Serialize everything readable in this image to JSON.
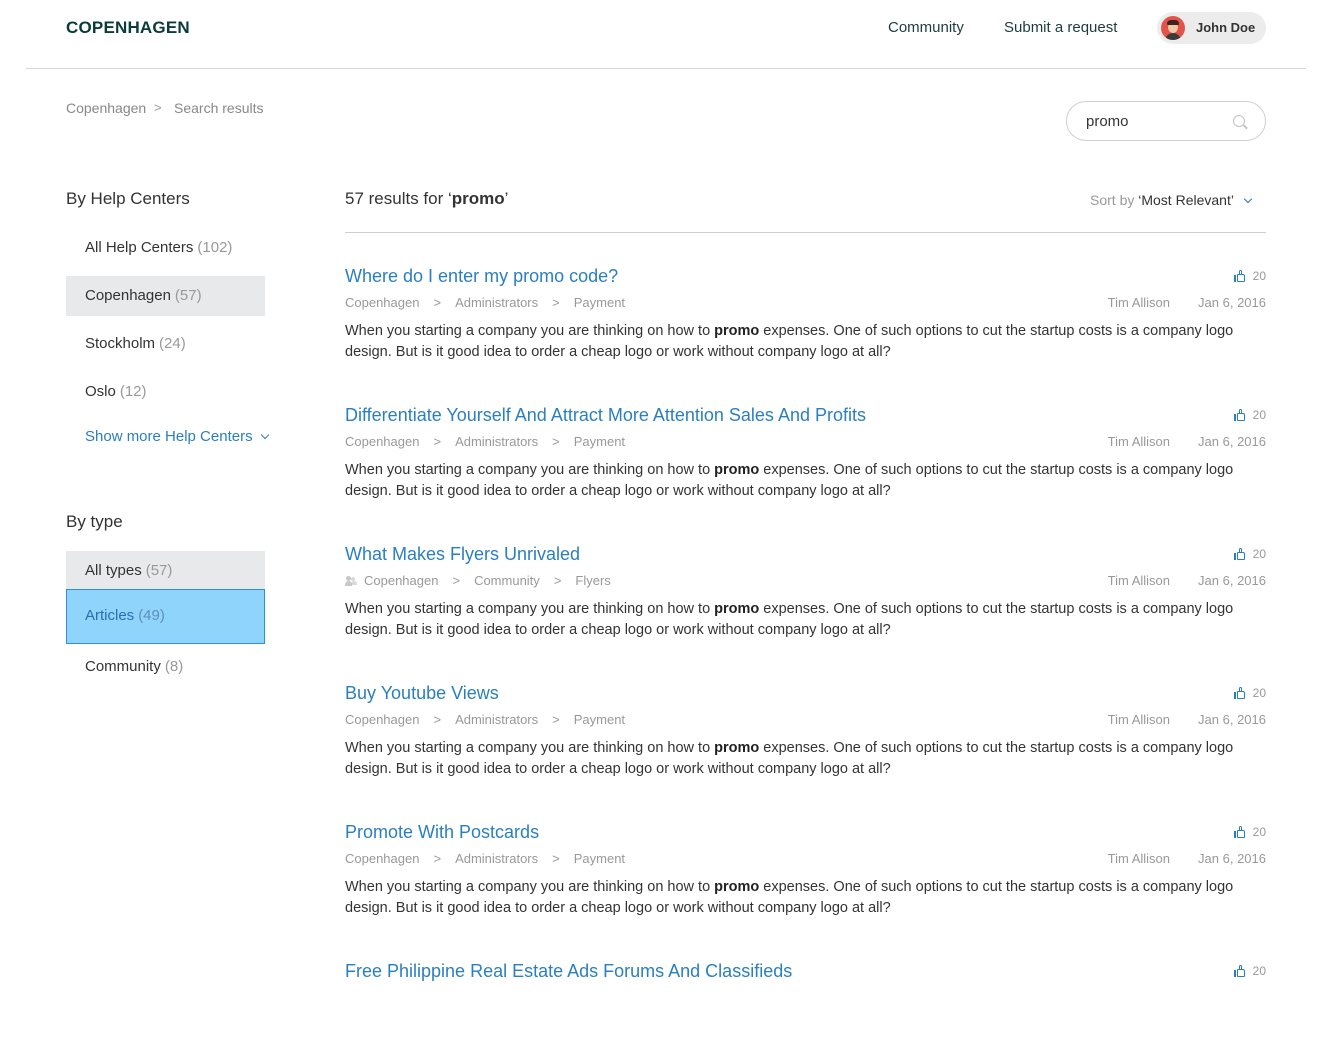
{
  "header": {
    "logo": "COPENHAGEN",
    "nav": {
      "community": "Community",
      "submit_request": "Submit a request"
    },
    "user_name": "John Doe"
  },
  "breadcrumb": {
    "home": "Copenhagen",
    "separator": ">",
    "current": "Search results"
  },
  "search": {
    "value": "promo"
  },
  "sidebar": {
    "help_centers_heading": "By Help Centers",
    "help_centers": [
      {
        "label": "All Help Centers",
        "count": "(102)"
      },
      {
        "label": "Copenhagen",
        "count": "(57)"
      },
      {
        "label": "Stockholm",
        "count": "(24)"
      },
      {
        "label": "Oslo",
        "count": "(12)"
      }
    ],
    "show_more": "Show more Help Centers",
    "type_heading": "By type",
    "types": [
      {
        "label": "All types",
        "count": "(57)"
      },
      {
        "label": "Articles",
        "count": "(49)"
      },
      {
        "label": "Community",
        "count": "(8)"
      }
    ]
  },
  "results_header": {
    "count_prefix": "57 results for ‘",
    "query": "promo",
    "count_suffix": "’",
    "sort_label": "Sort by",
    "sort_value": "‘Most Relevant’"
  },
  "body_text": {
    "before": "When you starting a company you are thinking on how to ",
    "bold": "promo",
    "after": " expenses. One of such options to cut the startup costs is a company logo design. But is it good idea to order a cheap logo or work without company logo at all?"
  },
  "results": [
    {
      "title": "Where do I enter my promo code?",
      "votes": "20",
      "path": [
        "Copenhagen",
        "Administrators",
        "Payment"
      ],
      "author": "Tim Allison",
      "date": "Jan 6, 2016"
    },
    {
      "title": "Differentiate Yourself And Attract More Attention Sales And Profits",
      "votes": "20",
      "path": [
        "Copenhagen",
        "Administrators",
        "Payment"
      ],
      "author": "Tim Allison",
      "date": "Jan 6, 2016"
    },
    {
      "title": "What Makes Flyers Unrivaled",
      "votes": "20",
      "path": [
        "Copenhagen",
        "Community",
        "Flyers"
      ],
      "author": "Tim Allison",
      "date": "Jan 6, 2016"
    },
    {
      "title": "Buy Youtube Views",
      "votes": "20",
      "path": [
        "Copenhagen",
        "Administrators",
        "Payment"
      ],
      "author": "Tim Allison",
      "date": "Jan 6, 2016"
    },
    {
      "title": "Promote With Postcards",
      "votes": "20",
      "path": [
        "Copenhagen",
        "Administrators",
        "Payment"
      ],
      "author": "Tim Allison",
      "date": "Jan 6, 2016"
    },
    {
      "title": "Free Philippine Real Estate Ads Forums And Classifieds",
      "votes": "20"
    }
  ]
}
